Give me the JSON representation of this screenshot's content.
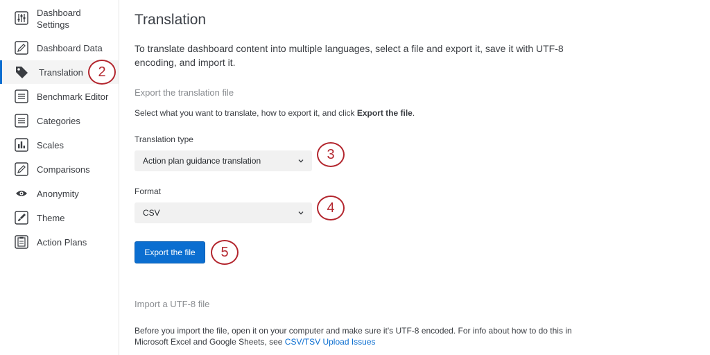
{
  "sidebar": {
    "items": [
      {
        "label": "Dashboard\nSettings",
        "icon": "sliders-icon"
      },
      {
        "label": "Dashboard Data",
        "icon": "pencil-icon"
      },
      {
        "label": "Translation",
        "icon": "tag-icon"
      },
      {
        "label": "Benchmark Editor",
        "icon": "list-icon"
      },
      {
        "label": "Categories",
        "icon": "list-icon"
      },
      {
        "label": "Scales",
        "icon": "bar-chart-icon"
      },
      {
        "label": "Comparisons",
        "icon": "pencil-icon"
      },
      {
        "label": "Anonymity",
        "icon": "eye-icon"
      },
      {
        "label": "Theme",
        "icon": "paintbrush-icon"
      },
      {
        "label": "Action Plans",
        "icon": "clipboard-icon"
      }
    ],
    "active": "Translation"
  },
  "main": {
    "title": "Translation",
    "intro": "To translate dashboard content into multiple languages, select a file and export it, save it with UTF-8 encoding, and import it.",
    "export_section": {
      "heading": "Export the translation file",
      "instructions_prefix": "Select what you want to translate, how to export it, and click ",
      "instructions_bold": "Export the file",
      "instructions_suffix": ".",
      "translation_type_label": "Translation type",
      "translation_type_value": "Action plan guidance translation",
      "format_label": "Format",
      "format_value": "CSV",
      "export_button": "Export the file"
    },
    "import_section": {
      "heading": "Import a UTF-8 file",
      "text": "Before you import the file, open it on your computer and make sure it's UTF-8 encoded. For info about how to do this in Microsoft Excel and Google Sheets, see ",
      "link": "CSV/TSV Upload Issues"
    }
  },
  "callouts": [
    "2",
    "3",
    "4",
    "5"
  ],
  "colors": {
    "accent": "#0b6ed0",
    "callout": "#b3262e"
  }
}
